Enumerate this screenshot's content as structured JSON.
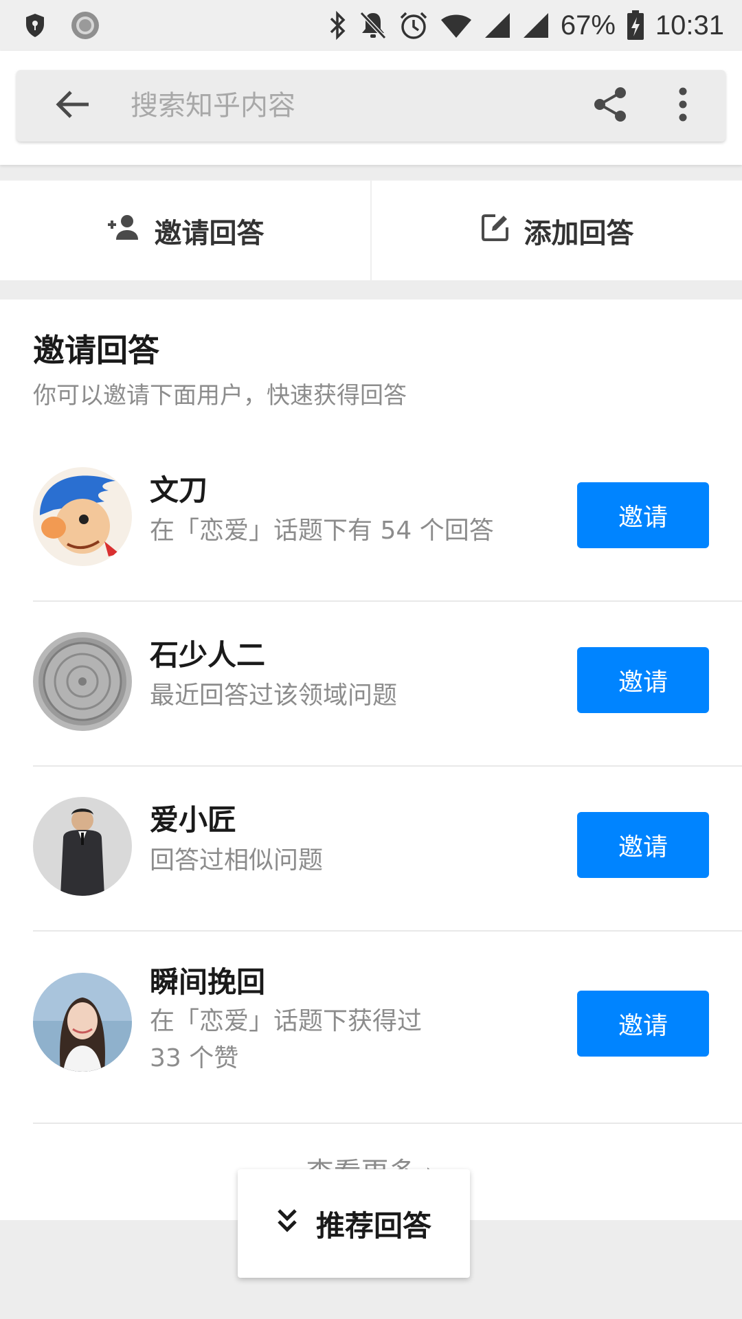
{
  "status_bar": {
    "battery": "67%",
    "time": "10:31",
    "icons": [
      "shield-icon",
      "record-icon",
      "bluetooth-icon",
      "mute-icon",
      "alarm-icon",
      "wifi-icon",
      "signal-icon",
      "signal-icon",
      "battery-charging-icon"
    ]
  },
  "search": {
    "placeholder": "搜索知乎内容",
    "icons": [
      "back-arrow-icon",
      "share-icon",
      "more-vertical-icon"
    ]
  },
  "actions": {
    "invite_label": "邀请回答",
    "add_label": "添加回答",
    "icons": [
      "add-person-icon",
      "edit-icon"
    ]
  },
  "invite_section": {
    "title": "邀请回答",
    "subtitle": "你可以邀请下面用户，快速获得回答",
    "users": [
      {
        "name": "文刀",
        "description": "在「恋爱」话题下有 54 个回答",
        "button": "邀请",
        "avatar": "cartoon-avatar"
      },
      {
        "name": "石少人二",
        "description": "最近回答过该领域问题",
        "button": "邀请",
        "avatar": "manhole-cover-avatar"
      },
      {
        "name": "爱小匠",
        "description": "回答过相似问题",
        "button": "邀请",
        "avatar": "man-in-suit-avatar"
      },
      {
        "name": "瞬间挽回",
        "description": "在「恋爱」话题下获得过 33 个赞",
        "button": "邀请",
        "avatar": "woman-portrait-avatar"
      }
    ],
    "see_more": "查看更多 ›"
  },
  "float_button": {
    "label": "推荐回答",
    "icon": "double-chevron-down-icon"
  },
  "colors": {
    "accent": "#0084ff",
    "status_bar_bg": "#efefef",
    "page_bg": "#ededed",
    "muted_text": "#8c8c8c"
  }
}
